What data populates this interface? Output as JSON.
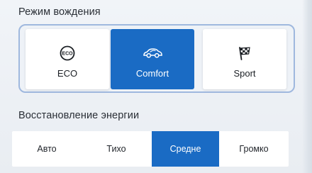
{
  "drive_mode": {
    "title": "Режим вождения",
    "options": [
      {
        "label": "ECO",
        "icon": "eco-icon",
        "selected": false
      },
      {
        "label": "Comfort",
        "icon": "car-comfort-icon",
        "selected": true
      },
      {
        "label": "Sport",
        "icon": "checkered-flag-icon",
        "selected": false
      }
    ]
  },
  "regeneration": {
    "title": "Восстановление энергии",
    "options": [
      {
        "label": "Авто",
        "selected": false
      },
      {
        "label": "Тихо",
        "selected": false
      },
      {
        "label": "Средне",
        "selected": true
      },
      {
        "label": "Громко",
        "selected": false
      }
    ]
  },
  "colors": {
    "accent": "#1a6bc4",
    "group_border": "#9fb8de",
    "background": "#eef2f7"
  }
}
